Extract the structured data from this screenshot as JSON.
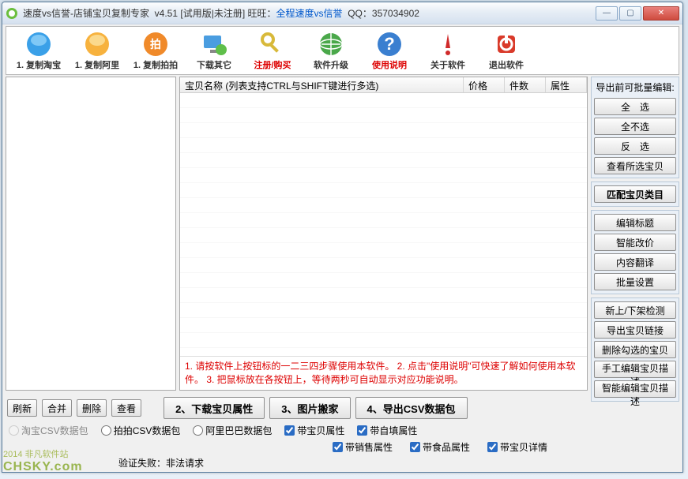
{
  "title": {
    "app": "速度vs信誉-店铺宝贝复制专家",
    "version": "v4.51",
    "trial": "[试用版|未注册]",
    "ww_label": "旺旺：",
    "ww_value": "全程速度vs信誉",
    "qq_label": "QQ：",
    "qq_value": "357034902"
  },
  "toolbar": [
    {
      "name": "copy-taobao",
      "label": "1. 复制淘宝",
      "icon": "taobao",
      "red": false
    },
    {
      "name": "copy-ali",
      "label": "1. 复制阿里",
      "icon": "ali",
      "red": false
    },
    {
      "name": "copy-paipai",
      "label": "1. 复制拍拍",
      "icon": "paipai",
      "red": false
    },
    {
      "name": "download-other",
      "label": "下载其它",
      "icon": "monitor",
      "red": false
    },
    {
      "name": "register-buy",
      "label": "注册/购买",
      "icon": "key",
      "red": true
    },
    {
      "name": "software-upgrade",
      "label": "软件升级",
      "icon": "globe",
      "red": false
    },
    {
      "name": "usage-help",
      "label": "使用说明",
      "icon": "help",
      "red": true
    },
    {
      "name": "about-software",
      "label": "关于软件",
      "icon": "exclaim",
      "red": false
    },
    {
      "name": "exit-software",
      "label": "退出软件",
      "icon": "exit",
      "red": false
    }
  ],
  "list": {
    "col_name": "宝贝名称  (列表支持CTRL与SHIFT键进行多选)",
    "col_price": "价格",
    "col_count": "件数",
    "col_attr": "属性",
    "hint": "1. 请按软件上按钮标的一二三四步骤使用本软件。 2. 点击\"使用说明\"可快速了解如何使用本软件。 3. 把鼠标放在各按钮上，等待两秒可自动显示对应功能说明。"
  },
  "side": {
    "title1": "导出前可批量编辑:",
    "select_all": "全　选",
    "select_none": "全不选",
    "invert": "反　选",
    "view_selected": "查看所选宝贝",
    "match_cat": "匹配宝贝类目",
    "edit_title": "编辑标题",
    "smart_price": "智能改价",
    "translate": "内容翻译",
    "batch_set": "批量设置",
    "shelf_detect": "新上/下架检测",
    "export_links": "导出宝贝链接",
    "del_checked": "删除勾选的宝贝",
    "manual_desc": "手工编辑宝贝描述",
    "smart_desc": "智能编辑宝贝描述"
  },
  "bottom": {
    "refresh": "刷新",
    "merge": "合并",
    "delete": "删除",
    "view": "查看",
    "b2": "2、下载宝贝属性",
    "b3": "3、图片搬家",
    "b4": "4、导出CSV数据包",
    "r1": "淘宝CSV数据包",
    "r2": "拍拍CSV数据包",
    "r3": "阿里巴巴数据包",
    "c1": "带宝贝属性",
    "c2": "带自填属性",
    "c3": "带销售属性",
    "c4": "带食品属性",
    "c5": "带宝贝详情",
    "status": "验证失败：非法请求"
  },
  "watermark": {
    "l1": "非凡软件站",
    "l2": "CHSKY.com",
    "l3": "2014"
  }
}
